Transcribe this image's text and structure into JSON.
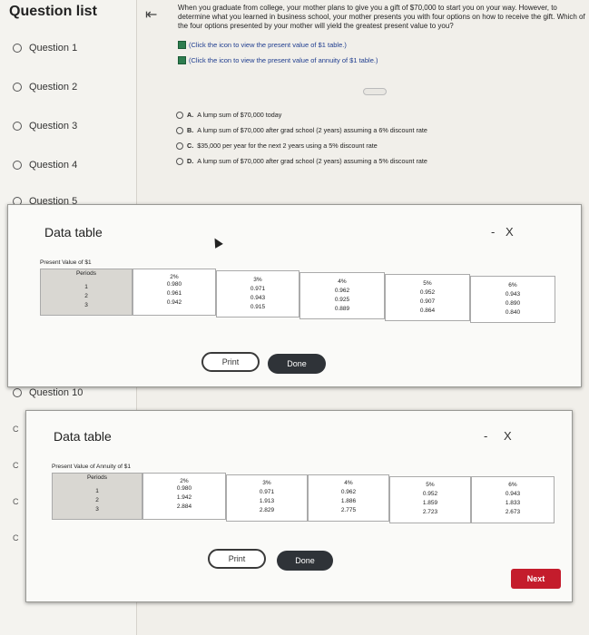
{
  "sidebar": {
    "title": "Question list",
    "items": [
      "Question 1",
      "Question 2",
      "Question 3",
      "Question 4",
      "Question 5",
      "Question 10"
    ]
  },
  "collapse_icon": "collapse-left-icon",
  "question": {
    "text": "When you graduate from college, your mother plans to give you a gift of $70,000 to start you on your way. However, to determine what you learned in business school, your mother presents you with four options on how to receive the gift. Which of the four options presented by your mother will yield the greatest present value to you?",
    "link1": "(Click the icon to view the present value of $1 table.)",
    "link2": "(Click the icon to view the present value of annuity of $1 table.)",
    "options": [
      {
        "letter": "A.",
        "text": "A lump sum of $70,000 today"
      },
      {
        "letter": "B.",
        "text": "A lump sum of $70,000 after grad school (2 years) assuming a 6% discount rate"
      },
      {
        "letter": "C.",
        "text": "$35,000 per year for the next 2 years using a 5% discount rate"
      },
      {
        "letter": "D.",
        "text": "A lump sum of $70,000 after grad school (2 years) assuming a 5% discount rate"
      }
    ]
  },
  "modal1": {
    "title": "Data table",
    "minimize": "-",
    "close": "X",
    "table_title": "Present Value of $1",
    "periods_label": "Periods",
    "periods": [
      "1",
      "2",
      "3"
    ],
    "columns": [
      {
        "rate": "2%",
        "values": [
          "0.980",
          "0.961",
          "0.942"
        ]
      },
      {
        "rate": "3%",
        "values": [
          "0.971",
          "0.943",
          "0.915"
        ]
      },
      {
        "rate": "4%",
        "values": [
          "0.962",
          "0.925",
          "0.889"
        ]
      },
      {
        "rate": "5%",
        "values": [
          "0.952",
          "0.907",
          "0.864"
        ]
      },
      {
        "rate": "6%",
        "values": [
          "0.943",
          "0.890",
          "0.840"
        ]
      }
    ],
    "print": "Print",
    "done": "Done"
  },
  "modal2": {
    "title": "Data table",
    "minimize": "-",
    "close": "X",
    "table_title": "Present Value of Annuity of $1",
    "periods_label": "Periods",
    "periods": [
      "1",
      "2",
      "3"
    ],
    "columns": [
      {
        "rate": "2%",
        "values": [
          "0.980",
          "1.942",
          "2.884"
        ]
      },
      {
        "rate": "3%",
        "values": [
          "0.971",
          "1.913",
          "2.829"
        ]
      },
      {
        "rate": "4%",
        "values": [
          "0.962",
          "1.886",
          "2.775"
        ]
      },
      {
        "rate": "5%",
        "values": [
          "0.952",
          "1.859",
          "2.723"
        ]
      },
      {
        "rate": "6%",
        "values": [
          "0.943",
          "1.833",
          "2.673"
        ]
      }
    ],
    "print": "Print",
    "done": "Done"
  },
  "next": "Next"
}
